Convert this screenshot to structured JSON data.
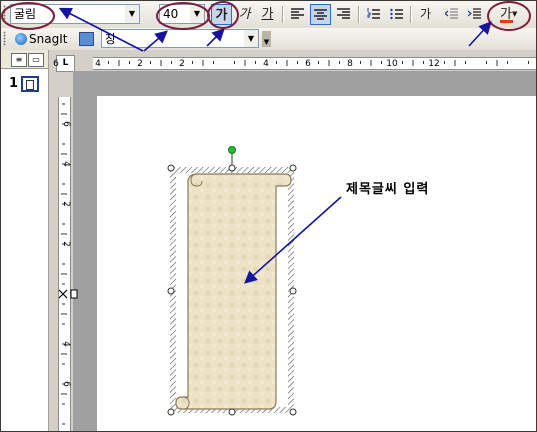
{
  "toolbar": {
    "font_name": "굴림",
    "font_size": "40",
    "bold_label": "가",
    "italic_label": "가",
    "underline_label": "가",
    "small_caps_label": "가",
    "font_color_label": "가",
    "font_color_bar": "#e8380d"
  },
  "toolbar2": {
    "snagit_label": "SnagIt",
    "window_combo_value": "창"
  },
  "slides": {
    "number": "1"
  },
  "ruler": {
    "corner_label": "L",
    "h_labels": [
      "6",
      "4",
      "2",
      "2",
      "4",
      "6",
      "8",
      "10",
      "12"
    ],
    "v_labels": [
      "6",
      "4",
      "2",
      "2",
      "4",
      "6"
    ]
  },
  "annotation": {
    "text": "제목글씨 입력"
  },
  "colors": {
    "annotation_arrow": "#1414a0",
    "highlight_ring": "#7b1f3a",
    "scroll_fill": "#ece2c6",
    "scroll_stroke": "#8b7a55"
  }
}
